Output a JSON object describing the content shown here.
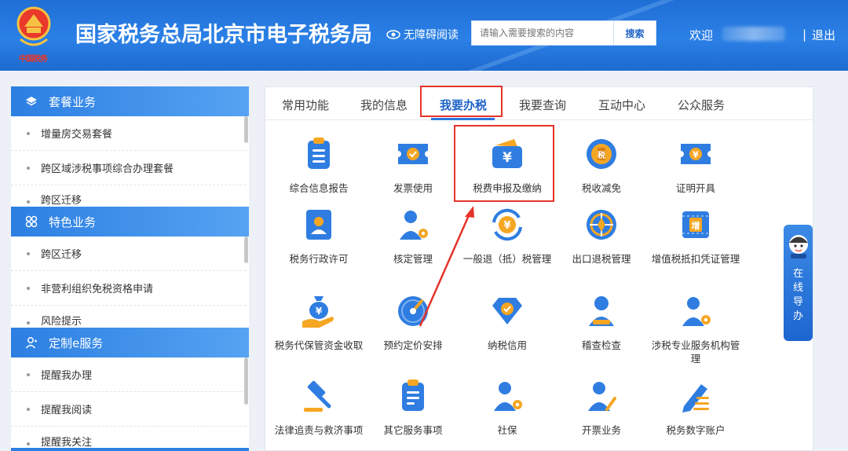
{
  "header": {
    "emblem_text": "中国税务",
    "title": "国家税务总局北京市电子税务局",
    "accessibility": "无障碍阅读",
    "search_placeholder": "请输入需要搜索的内容",
    "search_button": "搜索",
    "welcome": "欢迎",
    "separator": "|",
    "logout": "退出"
  },
  "sidebar": {
    "sections": [
      {
        "title": "套餐业务",
        "icon": "layers-icon",
        "items": [
          "增量房交易套餐",
          "跨区域涉税事项综合办理套餐",
          "跨区迁移"
        ]
      },
      {
        "title": "特色业务",
        "icon": "grid-icon",
        "items": [
          "跨区迁移",
          "非营利组织免税资格申请",
          "风险提示"
        ]
      },
      {
        "title": "定制e服务",
        "icon": "user-icon",
        "items": [
          "提醒我办理",
          "提醒我阅读",
          "提醒我关注"
        ]
      }
    ]
  },
  "tabs": [
    "常用功能",
    "我的信息",
    "我要办税",
    "我要查询",
    "互动中心",
    "公众服务"
  ],
  "active_tab": "我要办税",
  "services": [
    {
      "label": "综合信息报告",
      "icon": "clipboard-icon"
    },
    {
      "label": "发票使用",
      "icon": "ticket-icon"
    },
    {
      "label": "税费申报及缴纳",
      "icon": "wallet-icon"
    },
    {
      "label": "税收减免",
      "icon": "coin-icon"
    },
    {
      "label": "证明开具",
      "icon": "certificate-icon"
    },
    {
      "label": "税务行政许可",
      "icon": "id-card-icon"
    },
    {
      "label": "核定管理",
      "icon": "user-gear-icon"
    },
    {
      "label": "一般退（抵）税管理",
      "icon": "refund-icon"
    },
    {
      "label": "出口退税管理",
      "icon": "globe-icon"
    },
    {
      "label": "增值税抵扣凭证管理",
      "icon": "vat-icon"
    },
    {
      "label": "税务代保管资金收取",
      "icon": "money-bag-icon"
    },
    {
      "label": "预约定价安排",
      "icon": "gauge-icon"
    },
    {
      "label": "纳税信用",
      "icon": "diamond-icon"
    },
    {
      "label": "稽查检查",
      "icon": "inspector-icon"
    },
    {
      "label": "涉税专业服务机构管理",
      "icon": "agency-icon"
    },
    {
      "label": "法律追责与救济事项",
      "icon": "gavel-icon"
    },
    {
      "label": "其它服务事项",
      "icon": "document-icon"
    },
    {
      "label": "社保",
      "icon": "social-security-icon"
    },
    {
      "label": "开票业务",
      "icon": "invoice-user-icon"
    },
    {
      "label": "税务数字账户",
      "icon": "pen-icon"
    }
  ],
  "online_guide": {
    "label": "在线导办",
    "chars": [
      "在",
      "线",
      "导",
      "办"
    ]
  },
  "colors": {
    "brand": "#2a77dc",
    "highlight": "#e6332a",
    "icon_blue": "#2f7de1",
    "icon_orange": "#f5a623"
  }
}
